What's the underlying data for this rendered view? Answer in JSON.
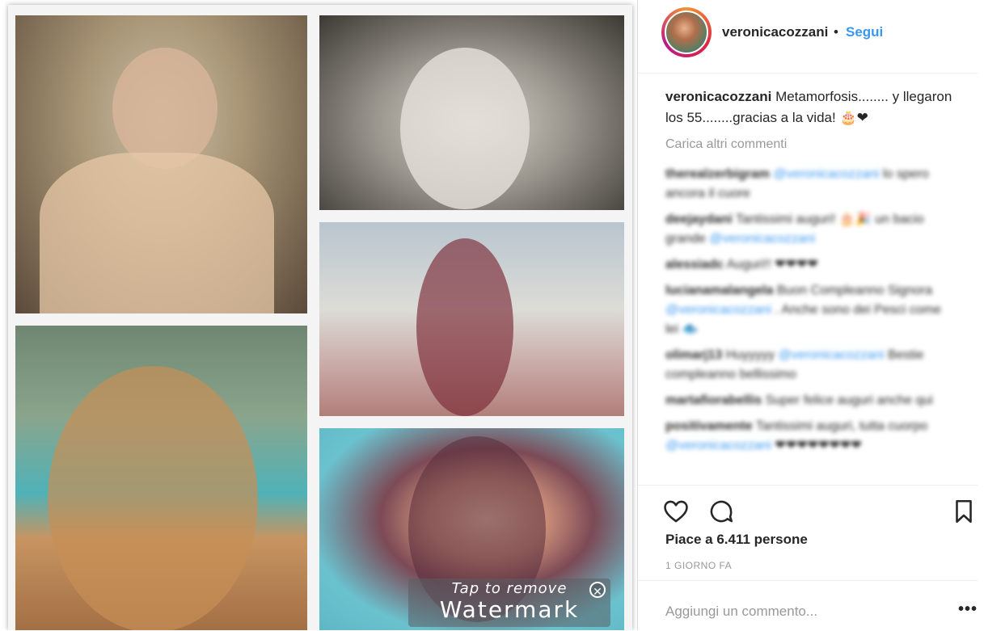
{
  "post": {
    "images": [
      {
        "name": "photo-baby"
      },
      {
        "name": "photo-child-bw"
      },
      {
        "name": "photo-young-woman-sitting"
      },
      {
        "name": "photo-sunglasses-selfie"
      },
      {
        "name": "photo-portrait-80s"
      }
    ],
    "watermark": {
      "line1": "Tap to remove",
      "line2": "Watermark",
      "close": "✕"
    }
  },
  "header": {
    "username": "veronicacozzani",
    "separator": "•",
    "follow": "Segui"
  },
  "caption": {
    "username": "veronicacozzani",
    "text": "Metamorfosis........ y llegaron los 55........gracias a la vida! 🎂❤"
  },
  "load_more": "Carica altri commenti",
  "comments": [
    {
      "user": "therealzerbigram",
      "mention": "@veronicacozzani",
      "text": "lo spero ancora il cuore"
    },
    {
      "user": "deejaydani",
      "text": "Tantissimi auguri! 🎂🎉 un bacio grande",
      "mention": "@veronicacozzani"
    },
    {
      "user": "alessiadc",
      "text": "Auguri!! ❤❤❤❤"
    },
    {
      "user": "lucianamalangela",
      "text": "Buon Compleanno Signora",
      "mention": "@veronicacozzani",
      "text2": ". Anche sono dei Pesci come lei 🐟"
    },
    {
      "user": "olimarj13",
      "text": "Huyyyyy",
      "mention": "@veronicacozzani",
      "text2": "Bestie compleanno bellissimo"
    },
    {
      "user": "martafiorabellis",
      "text": "Super felice auguri anche qui"
    },
    {
      "user": "positivamente",
      "text": "Tantissimi auguri, tutta cuorpo",
      "mention": "@veronicacozzani",
      "text2": "❤❤❤❤❤❤❤❤"
    }
  ],
  "likes": "Piace a 6.411 persone",
  "time": "1 GIORNO FA",
  "add_comment": {
    "placeholder": "Aggiungi un commento..."
  },
  "more": "•••",
  "icons": {
    "like": "heart-icon",
    "comment": "comment-icon",
    "save": "bookmark-icon"
  }
}
